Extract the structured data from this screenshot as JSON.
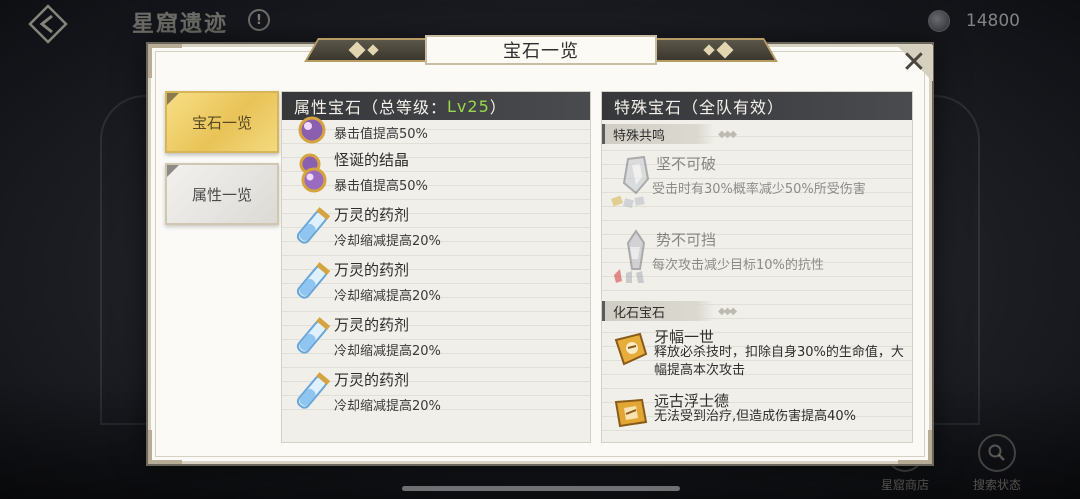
{
  "hud": {
    "title": "星窟遗迹",
    "info_glyph": "!",
    "currency_value": "14800",
    "shop_label": "星窟商店",
    "search_label": "搜索状态"
  },
  "modal": {
    "title": "宝石一览",
    "close_glyph": "✕"
  },
  "tabs": [
    {
      "label": "宝石一览",
      "active": true
    },
    {
      "label": "属性一览",
      "active": false
    }
  ],
  "left_panel": {
    "header_prefix": "属性宝石（总等级：",
    "header_level": "Lv25",
    "header_suffix": "）",
    "gems": [
      {
        "name": "",
        "desc": "暴击值提高50%",
        "icon": "purple-orb-icon"
      },
      {
        "name": "怪诞的结晶",
        "desc": "暴击值提高50%",
        "icon": "purple-orb-icon"
      },
      {
        "name": "万灵的药剂",
        "desc": "冷却缩减提高20%",
        "icon": "potion-vial-icon"
      },
      {
        "name": "万灵的药剂",
        "desc": "冷却缩减提高20%",
        "icon": "potion-vial-icon"
      },
      {
        "name": "万灵的药剂",
        "desc": "冷却缩减提高20%",
        "icon": "potion-vial-icon"
      },
      {
        "name": "万灵的药剂",
        "desc": "冷却缩减提高20%",
        "icon": "potion-vial-icon"
      }
    ]
  },
  "right_panel": {
    "header": "特殊宝石（全队有效）",
    "resonance_title": "特殊共鸣",
    "resonances": [
      {
        "name": "坚不可破",
        "desc": "受击时有30%概率减少50%所受伤害",
        "icon": "armor-shield-icon"
      },
      {
        "name": "势不可挡",
        "desc": "每次攻击减少目标10%的抗性",
        "icon": "spear-crystal-icon"
      }
    ],
    "fossil_title": "化石宝石",
    "fossils": [
      {
        "name": "牙幅一世",
        "desc": "释放必杀技时，扣除自身30%的生命值，大幅提高本次攻击",
        "icon": "amber-fossil-icon"
      },
      {
        "name": "远古浮士德",
        "desc": "无法受到治疗,但造成伤害提高40%",
        "icon": "amber-fossil-icon"
      }
    ]
  },
  "colors": {
    "gold_tab": "#e8c358",
    "panel_header": "#36373a",
    "level_green": "#9ad84a"
  }
}
